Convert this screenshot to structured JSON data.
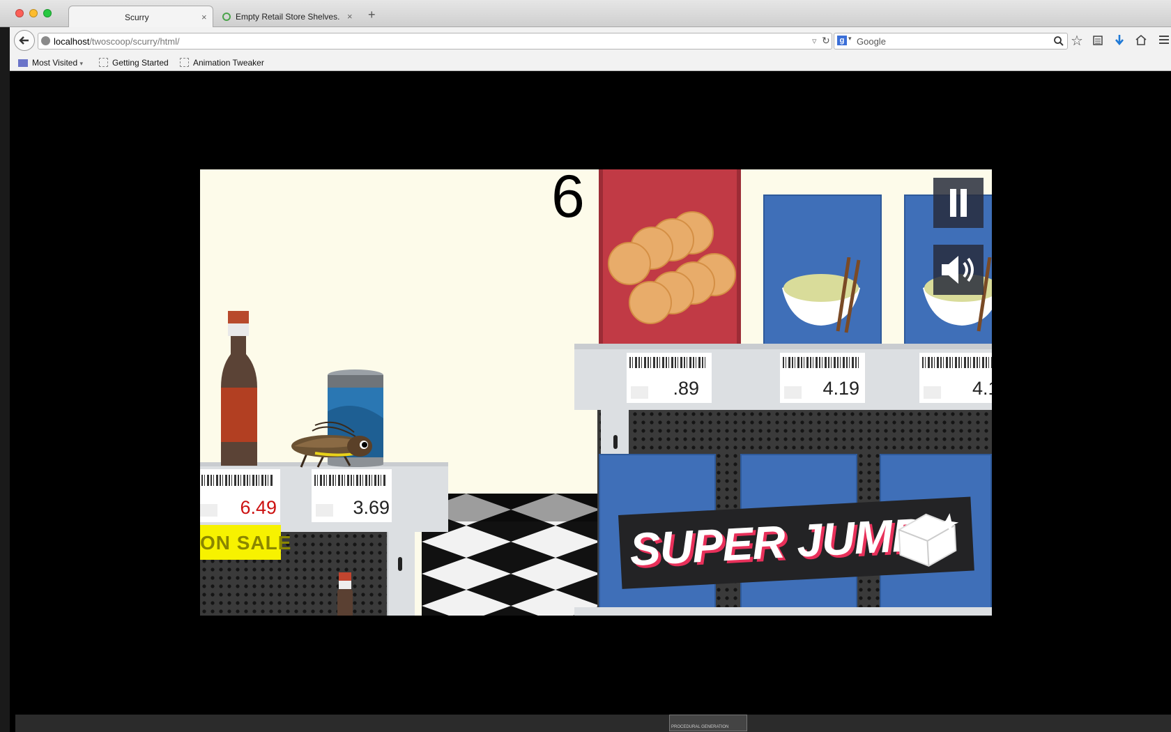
{
  "browser": {
    "tabs": [
      {
        "title": "Scurry",
        "active": true
      },
      {
        "title": "Empty Retail Store Shelves...",
        "active": false
      }
    ],
    "new_tab_symbol": "+",
    "close_symbol": "×",
    "url_host": "localhost",
    "url_path": "/twoscoop/scurry/html/",
    "search_engine": "Google",
    "search_placeholder": "Google",
    "bookmarks": [
      "Most Visited",
      "Getting Started",
      "Animation Tweaker"
    ],
    "icons": [
      "back-arrow-icon",
      "globe-icon",
      "reload-icon",
      "search-icon",
      "star-icon",
      "reading-list-icon",
      "download-icon",
      "home-icon",
      "menu-icon"
    ]
  },
  "game": {
    "score": "6",
    "prices": {
      "left_sauce": "6.49",
      "left_can": "3.69",
      "right_1": ".89",
      "right_2": "4.19",
      "right_3": "4.1"
    },
    "sale_sign": "ON SALE",
    "banner": "SUPER JUMP!",
    "buttons": {
      "pause": "pause-icon",
      "sound": "speaker-icon"
    },
    "colors": {
      "wall": "#fdfbea",
      "box_blue": "#3f6fb8",
      "cracker_red": "#c13a45",
      "sale_yellow": "#f7f200",
      "banner_pink": "#e8305a",
      "sale_price_red": "#cc1111"
    }
  },
  "taskbar": {
    "thumb_label": "PROCEDURAL GENERATION"
  }
}
